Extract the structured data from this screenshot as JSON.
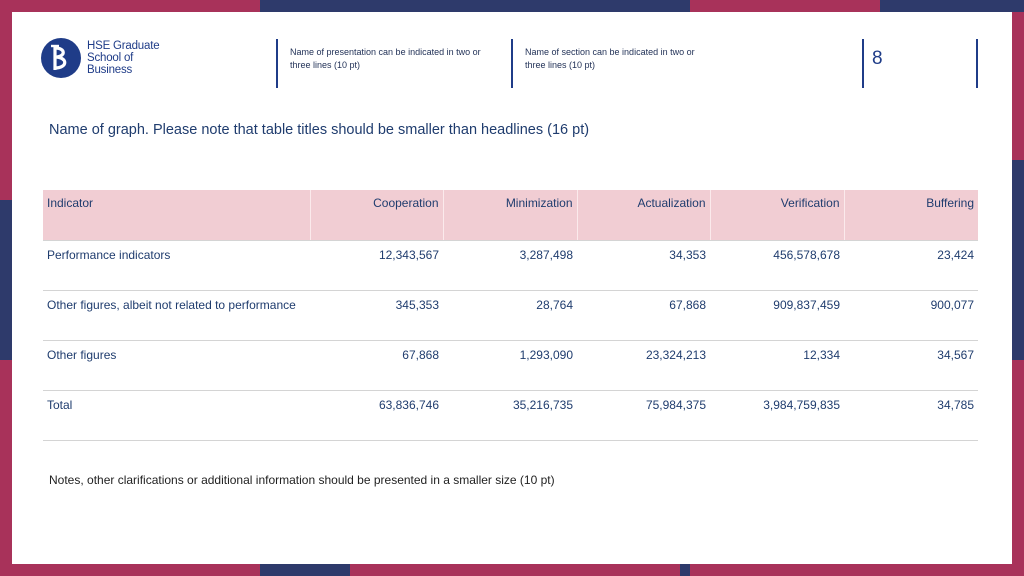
{
  "header": {
    "logo_line1": "HSE Graduate",
    "logo_line2": "School of Business",
    "presentation_name": "Name of presentation can be indicated in two or three lines (10 pt)",
    "section_name": "Name of section can be indicated in two or three lines (10 pt)",
    "page_number": "8"
  },
  "graph_title": "Name of graph. Please note that table titles should be smaller than headlines (16 pt)",
  "table": {
    "headers": [
      "Indicator",
      "Cooperation",
      "Minimization",
      "Actualization",
      "Verification",
      "Buffering"
    ],
    "rows": [
      [
        "Performance indicators",
        "12,343,567",
        "3,287,498",
        "34,353",
        "456,578,678",
        "23,424"
      ],
      [
        "Other figures, albeit not related to performance",
        "345,353",
        "28,764",
        "67,868",
        "909,837,459",
        "900,077"
      ],
      [
        "Other figures",
        "67,868",
        "1,293,090",
        "23,324,213",
        "12,334",
        "34,567"
      ],
      [
        "Total",
        "63,836,746",
        "35,216,735",
        "75,984,375",
        "3,984,759,835",
        "34,785"
      ]
    ]
  },
  "notes": "Notes, other clarifications or additional information should be presented in a smaller size (10 pt)",
  "colors": {
    "frame_red": "#a8325a",
    "frame_navy": "#2e3a6b",
    "brand_blue": "#1f3c88",
    "header_fill": "#f1cdd3"
  }
}
